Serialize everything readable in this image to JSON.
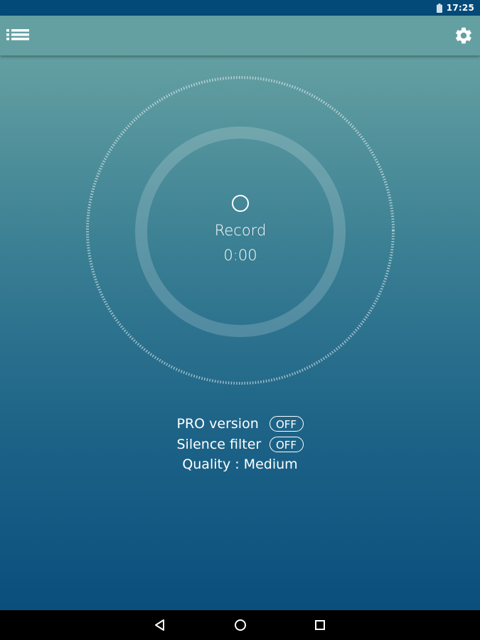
{
  "status_bar": {
    "time": "17:25",
    "icons": [
      "battery-icon"
    ]
  },
  "app_bar": {
    "icons": [
      "menu-list-icon",
      "settings-gear-icon"
    ]
  },
  "recorder": {
    "record_icon": "record-circle-icon",
    "record_label": "Record",
    "timer": "0:00"
  },
  "options": {
    "pro_label": "PRO version",
    "pro_value": "OFF",
    "silence_label": "Silence filter",
    "silence_value": "OFF",
    "quality_text": "Quality : Medium"
  },
  "nav_bar": {
    "icons": [
      "back-triangle-icon",
      "home-circle-icon",
      "recents-square-icon"
    ]
  },
  "colors": {
    "status_bar": "#034a78",
    "app_bar": "#64a0a2",
    "gradient_top": "#64a0a2",
    "gradient_bottom": "#0a4f7d",
    "nav_bar": "#000000"
  }
}
